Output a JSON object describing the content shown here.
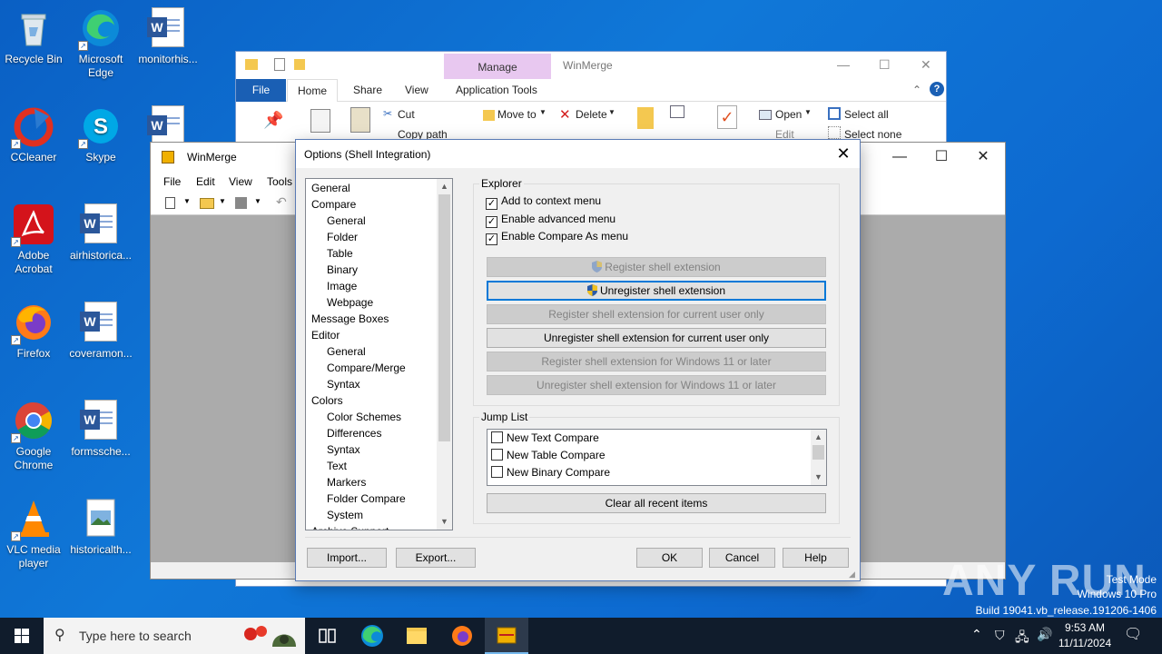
{
  "desktop": {
    "icons": [
      {
        "label": "Recycle Bin"
      },
      {
        "label": "Microsoft Edge"
      },
      {
        "label": "monitorhis..."
      },
      {
        "label": "CCleaner"
      },
      {
        "label": "Skype"
      },
      {
        "label": "Adobe Acrobat"
      },
      {
        "label": "airhistorica..."
      },
      {
        "label": "Firefox"
      },
      {
        "label": "coveramon..."
      },
      {
        "label": "Google Chrome"
      },
      {
        "label": "formssche..."
      },
      {
        "label": "VLC media player"
      },
      {
        "label": "historicalth..."
      }
    ]
  },
  "explorer": {
    "title": "WinMerge",
    "manage_tab": "Manage",
    "tabs": {
      "file": "File",
      "home": "Home",
      "share": "Share",
      "view": "View",
      "app_tools": "Application Tools"
    },
    "ribbon": {
      "cut": "Cut",
      "copy_path": "Copy path",
      "move_to": "Move to",
      "delete": "Delete",
      "open": "Open",
      "edit": "Edit",
      "select_all": "Select all",
      "select_none": "Select none"
    }
  },
  "winmerge": {
    "title": "WinMerge",
    "menu": {
      "file": "File",
      "edit": "Edit",
      "view": "View",
      "tools": "Tools"
    }
  },
  "dialog": {
    "title": "Options (Shell Integration)",
    "tree": [
      {
        "label": "General",
        "indent": 0
      },
      {
        "label": "Compare",
        "indent": 0
      },
      {
        "label": "General",
        "indent": 1
      },
      {
        "label": "Folder",
        "indent": 1
      },
      {
        "label": "Table",
        "indent": 1
      },
      {
        "label": "Binary",
        "indent": 1
      },
      {
        "label": "Image",
        "indent": 1
      },
      {
        "label": "Webpage",
        "indent": 1
      },
      {
        "label": "Message Boxes",
        "indent": 0
      },
      {
        "label": "Editor",
        "indent": 0
      },
      {
        "label": "General",
        "indent": 1
      },
      {
        "label": "Compare/Merge",
        "indent": 1
      },
      {
        "label": "Syntax",
        "indent": 1
      },
      {
        "label": "Colors",
        "indent": 0
      },
      {
        "label": "Color Schemes",
        "indent": 1
      },
      {
        "label": "Differences",
        "indent": 1
      },
      {
        "label": "Syntax",
        "indent": 1
      },
      {
        "label": "Text",
        "indent": 1
      },
      {
        "label": "Markers",
        "indent": 1
      },
      {
        "label": "Folder Compare",
        "indent": 1
      },
      {
        "label": "System",
        "indent": 1
      },
      {
        "label": "Archive Support",
        "indent": 0
      }
    ],
    "explorer_group": {
      "label": "Explorer",
      "checks": [
        {
          "label": "Add to context menu",
          "checked": true
        },
        {
          "label": "Enable advanced menu",
          "checked": true
        },
        {
          "label": "Enable Compare As menu",
          "checked": true
        }
      ],
      "buttons": [
        {
          "label": "Register shell extension",
          "enabled": false,
          "shield": true
        },
        {
          "label": "Unregister shell extension",
          "enabled": true,
          "shield": true,
          "focused": true
        },
        {
          "label": "Register shell extension for current user only",
          "enabled": false
        },
        {
          "label": "Unregister shell extension for current user only",
          "enabled": true
        },
        {
          "label": "Register shell extension for Windows 11 or later",
          "enabled": false
        },
        {
          "label": "Unregister shell extension for Windows 11 or later",
          "enabled": false
        }
      ]
    },
    "jump_list": {
      "label": "Jump List",
      "items": [
        {
          "label": "New Text Compare",
          "checked": false
        },
        {
          "label": "New Table Compare",
          "checked": false
        },
        {
          "label": "New Binary Compare",
          "checked": false
        }
      ],
      "clear_button": "Clear all recent items"
    },
    "footer": {
      "import": "Import...",
      "export": "Export...",
      "ok": "OK",
      "cancel": "Cancel",
      "help": "Help"
    }
  },
  "watermark": {
    "test_mode": "Test Mode",
    "edition": "Windows 10 Pro",
    "build": "Build 19041.vb_release.191206-1406",
    "brand": "ANY RUN"
  },
  "taskbar": {
    "search_placeholder": "Type here to search",
    "time": "9:53 AM",
    "date": "11/11/2024"
  },
  "colors": {
    "accent": "#0078d7",
    "desktop": "#1078d8",
    "taskbar": "#101c2c"
  }
}
